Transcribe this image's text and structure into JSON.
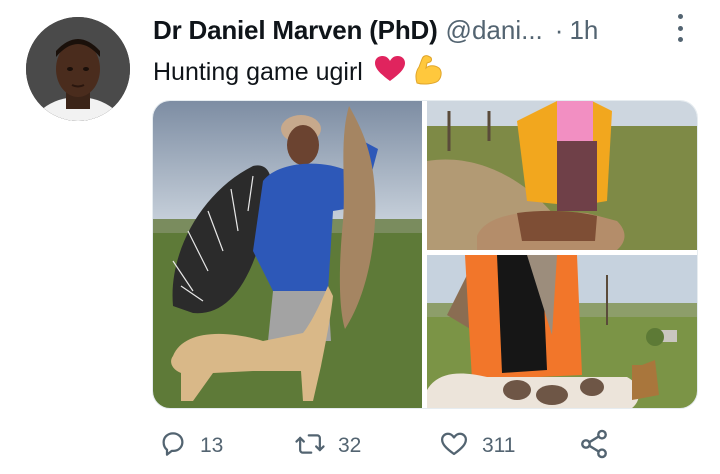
{
  "tweet": {
    "display_name": "Dr Daniel Marven (PhD)",
    "handle": "@dani...",
    "separator": "·",
    "time": "1h",
    "text": "Hunting game ugirl",
    "emojis": [
      "heart-emoji",
      "flexed-biceps-emoji"
    ]
  },
  "actions": {
    "replies": "13",
    "retweets": "32",
    "likes": "311"
  },
  "colors": {
    "text_primary": "#0f1419",
    "text_secondary": "#536471",
    "heart": "#e0245e",
    "biceps": "#ffc83d"
  },
  "icons": [
    "reply-icon",
    "retweet-icon",
    "like-icon",
    "share-icon",
    "more-icon"
  ]
}
